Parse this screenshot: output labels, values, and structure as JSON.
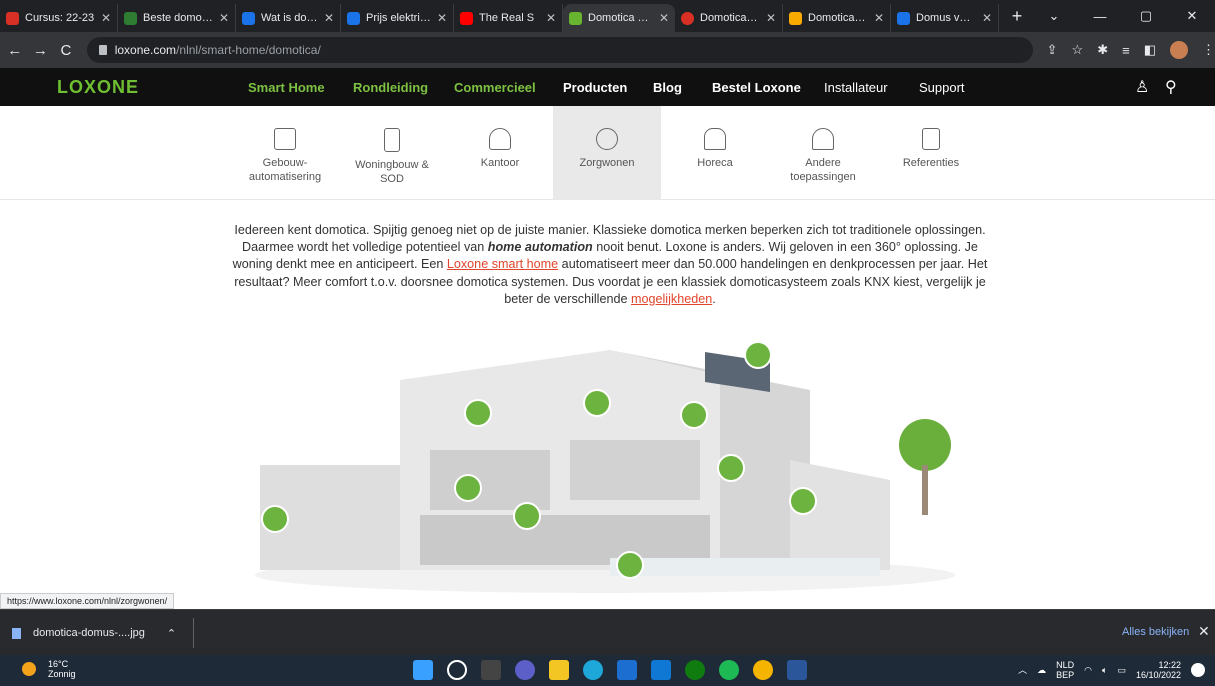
{
  "browser": {
    "tabs": [
      {
        "label": "Cursus: 22-23",
        "color": "#d93025",
        "active": false
      },
      {
        "label": "Beste domotica",
        "color": "#2e7d32",
        "active": false
      },
      {
        "label": "Wat is domotica",
        "color": "#1a73e8",
        "active": false
      },
      {
        "label": "Prijs elektricien",
        "color": "#1a73e8",
        "active": false
      },
      {
        "label": "The Real S",
        "color": "#ff0000",
        "active": false
      },
      {
        "label": "Domotica met",
        "color": "#69b42e",
        "active": true
      },
      {
        "label": "Domotica - Sl",
        "color": "#d93025",
        "active": false
      },
      {
        "label": "Domotica verg",
        "color": "#f9ab00",
        "active": false
      },
      {
        "label": "Domus voor d",
        "color": "#1a73e8",
        "active": false
      }
    ],
    "url_host": "loxone.com",
    "url_path": "/nlnl/smart-home/domotica/",
    "status_url": "https://www.loxone.com/nlnl/zorgwonen/"
  },
  "site": {
    "logo": "LOXONE",
    "nav": [
      {
        "label": "Smart Home"
      },
      {
        "label": "Rondleiding"
      },
      {
        "label": "Commercieel"
      },
      {
        "label": "Producten"
      },
      {
        "label": "Blog"
      },
      {
        "label": "Bestel Loxone"
      },
      {
        "label": "Installateur"
      },
      {
        "label": "Support"
      }
    ],
    "categories": [
      {
        "label": "Gebouw-automatisering",
        "icon": "search-icon"
      },
      {
        "label": "Woningbouw & SOD",
        "icon": "building-icon"
      },
      {
        "label": "Kantoor",
        "icon": "office-chair-icon"
      },
      {
        "label": "Zorgwonen",
        "icon": "people-icon"
      },
      {
        "label": "Horeca",
        "icon": "restaurant-icon"
      },
      {
        "label": "Andere toepassingen",
        "icon": "house-settings-icon"
      },
      {
        "label": "Referenties",
        "icon": "document-icon"
      }
    ],
    "intro": {
      "p1": "Iedereen kent domotica. Spijtig genoeg niet op de juiste manier. Klassieke domotica merken beperken zich tot traditionele oplossingen. Daarmee wordt het volledige potentieel van ",
      "em": "home automation",
      "p2": " nooit benut. Loxone is anders. Wij geloven in een 360° oplossing. Je woning denkt mee en anticipeert. Een ",
      "link1": "Loxone smart home",
      "p3": " automatiseert meer dan 50.000 handelingen en denkprocessen per jaar. Het resultaat? Meer comfort t.o.v. doorsnee domotica systemen. Dus voordat je een klassiek domoticasysteem zoals KNX kiest, vergelijk je beter de verschillende ",
      "link2": "mogelijkheden",
      "p4": "."
    }
  },
  "downloads": {
    "file": "domotica-domus-....jpg",
    "show_all": "Alles bekijken"
  },
  "taskbar": {
    "temp": "16°C",
    "condition": "Zonnig",
    "lang1": "NLD",
    "lang2": "BEP",
    "time": "12:22",
    "date": "16/10/2022"
  },
  "colors": {
    "brand_green": "#69b42e",
    "link_red": "#e1452b"
  }
}
